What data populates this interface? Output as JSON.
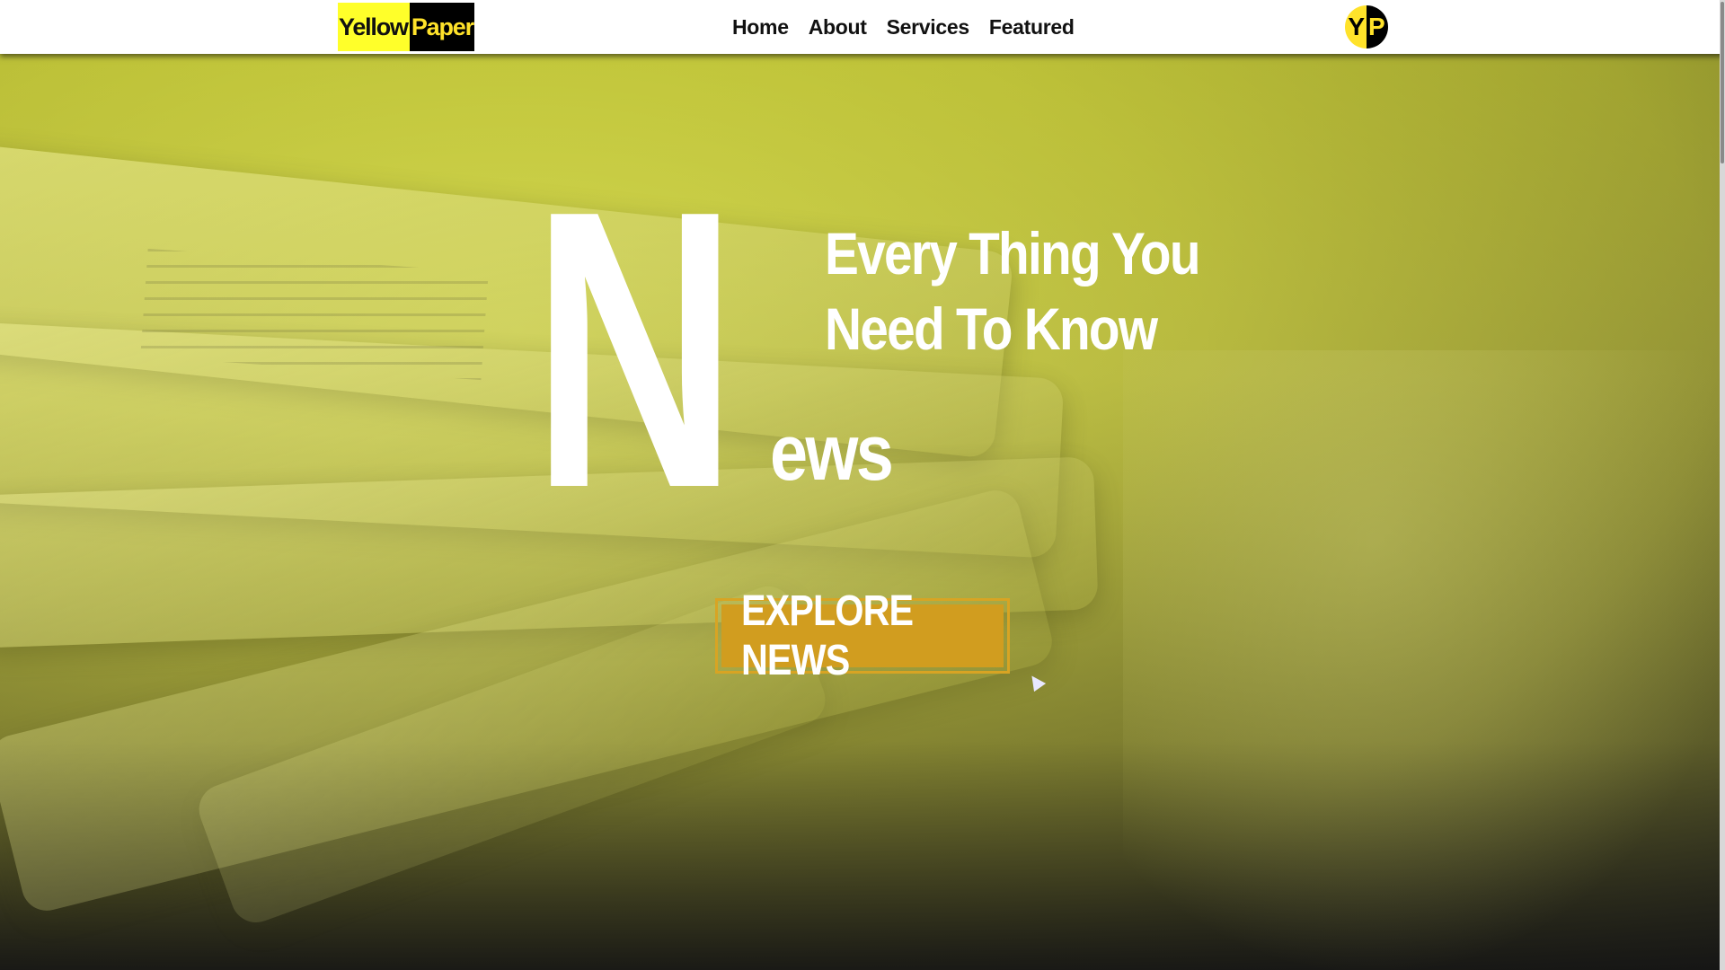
{
  "brand": {
    "part1": "Yellow",
    "part2": "Paper"
  },
  "nav": {
    "items": [
      "Home",
      "About",
      "Services",
      "Featured"
    ]
  },
  "avatar": {
    "left": "Y",
    "right": "P"
  },
  "hero": {
    "big_letter": "N",
    "tagline_line1": "Every Thing You",
    "tagline_line2": "Need To Know",
    "rest_word": "ews",
    "cta_label": "EXPLORE NEWS"
  },
  "colors": {
    "brand_yellow": "#ffff2a",
    "accent_gold": "#d19d1f",
    "dark": "#000000",
    "overlay_yellow": "#c9cc3a"
  }
}
